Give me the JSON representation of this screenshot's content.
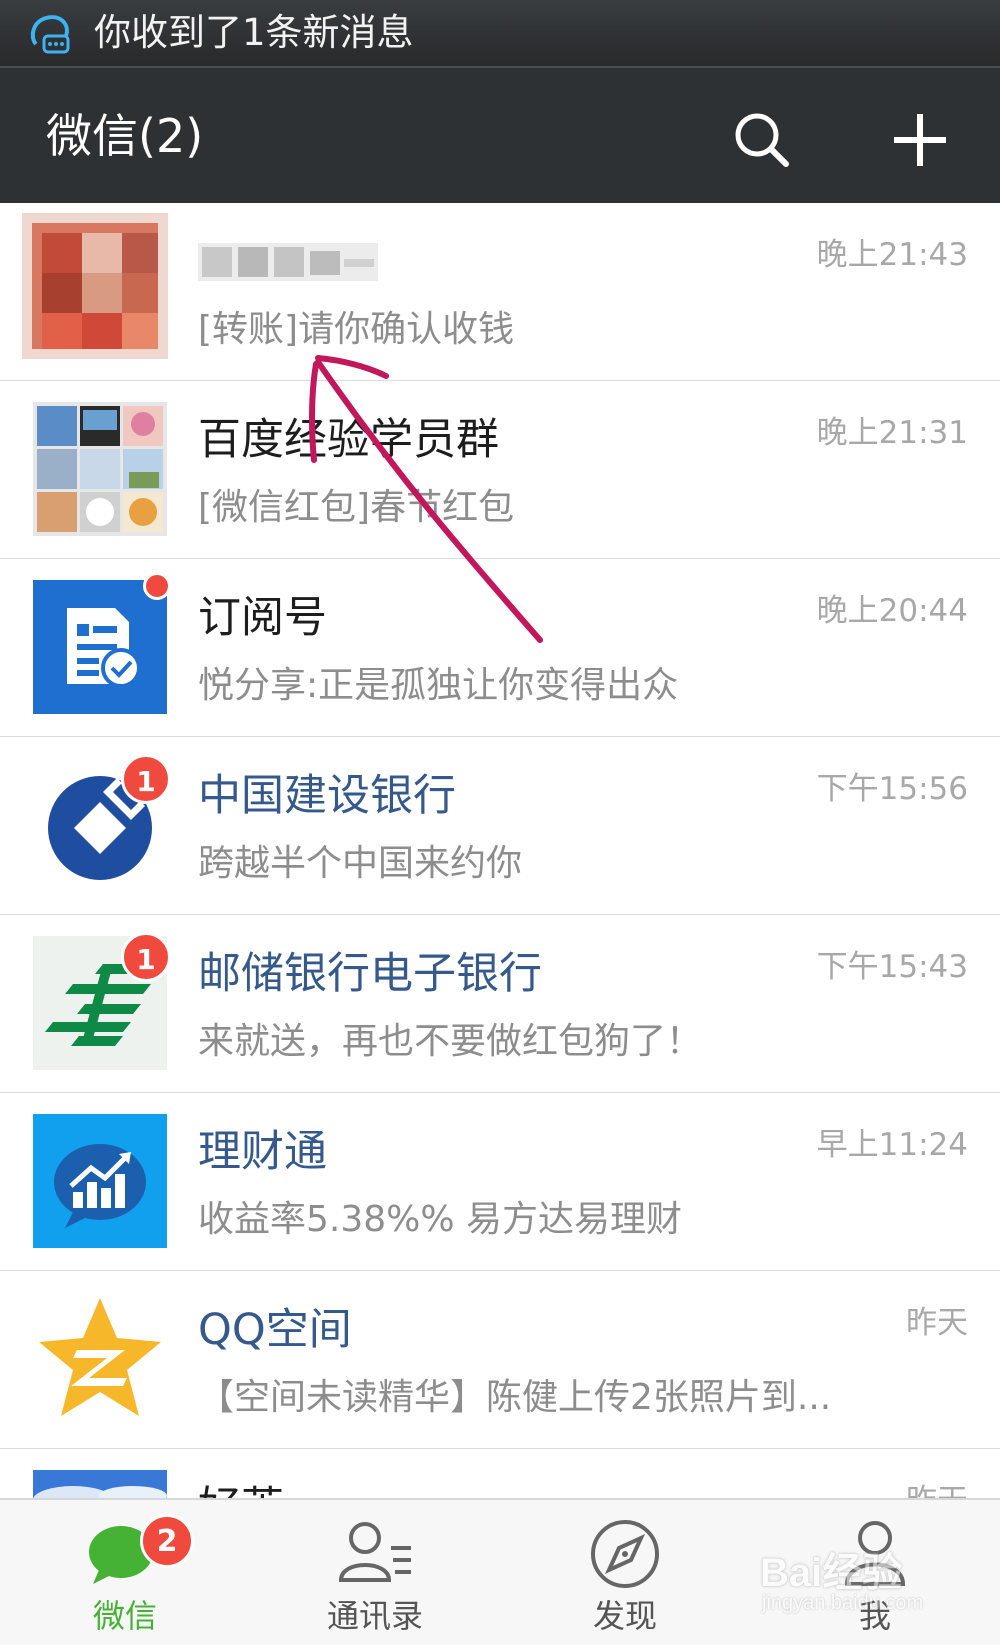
{
  "status_bar": {
    "notification_text": "你收到了1条新消息",
    "notification_icon": "chat-bubble-notification-icon"
  },
  "title_bar": {
    "title": "微信(2)",
    "search_icon": "search-icon",
    "add_icon": "plus-icon"
  },
  "chats": [
    {
      "name": "",
      "preview": "[转账]请你确认收钱",
      "time": "晚上21:43",
      "official": false,
      "avatar": "blurred-photo",
      "badge": ""
    },
    {
      "name": "百度经验学员群",
      "preview": "[微信红包]春节红包",
      "time": "晚上21:31",
      "official": false,
      "avatar": "group-photo-grid",
      "badge": ""
    },
    {
      "name": "订阅号",
      "preview": "悦分享:正是孤独让你变得出众",
      "time": "晚上20:44",
      "official": false,
      "avatar": "subscription-icon",
      "badge": "",
      "dot": true
    },
    {
      "name": "中国建设银行",
      "preview": "跨越半个中国来约你",
      "time": "下午15:56",
      "official": true,
      "avatar": "ccb-logo",
      "badge": "1"
    },
    {
      "name": "邮储银行电子银行",
      "preview": "来就送，再也不要做红包狗了！",
      "time": "下午15:43",
      "official": true,
      "avatar": "psbc-logo",
      "badge": "1"
    },
    {
      "name": "理财通",
      "preview": "收益率5.38%% 易方达易理财",
      "time": "早上11:24",
      "official": true,
      "avatar": "licaitong-logo",
      "badge": ""
    },
    {
      "name": "QQ空间",
      "preview": "【空间未读精华】陈健上传2张照片到...",
      "time": "昨天",
      "official": true,
      "avatar": "qzone-logo",
      "badge": ""
    },
    {
      "name": "好莱",
      "preview": "",
      "time": "昨天",
      "official": false,
      "avatar": "sky-photo",
      "badge": ""
    }
  ],
  "tabs": [
    {
      "label": "微信",
      "active": true,
      "icon": "chat-bubbles-icon",
      "badge": "2"
    },
    {
      "label": "通讯录",
      "active": false,
      "icon": "contacts-icon",
      "badge": ""
    },
    {
      "label": "发现",
      "active": false,
      "icon": "compass-icon",
      "badge": ""
    },
    {
      "label": "我",
      "active": false,
      "icon": "person-icon",
      "badge": ""
    }
  ],
  "watermark": {
    "main": "Bai",
    "brand_suffix": "经验",
    "sub": "jingyan.baidu.com"
  },
  "colors": {
    "status_bar": "#2e3134",
    "title_bar": "#2e3134",
    "active_tab": "#45b135",
    "badge": "#f04a3f",
    "official_name": "#36598c",
    "annotation_arrow": "#c2185b"
  }
}
